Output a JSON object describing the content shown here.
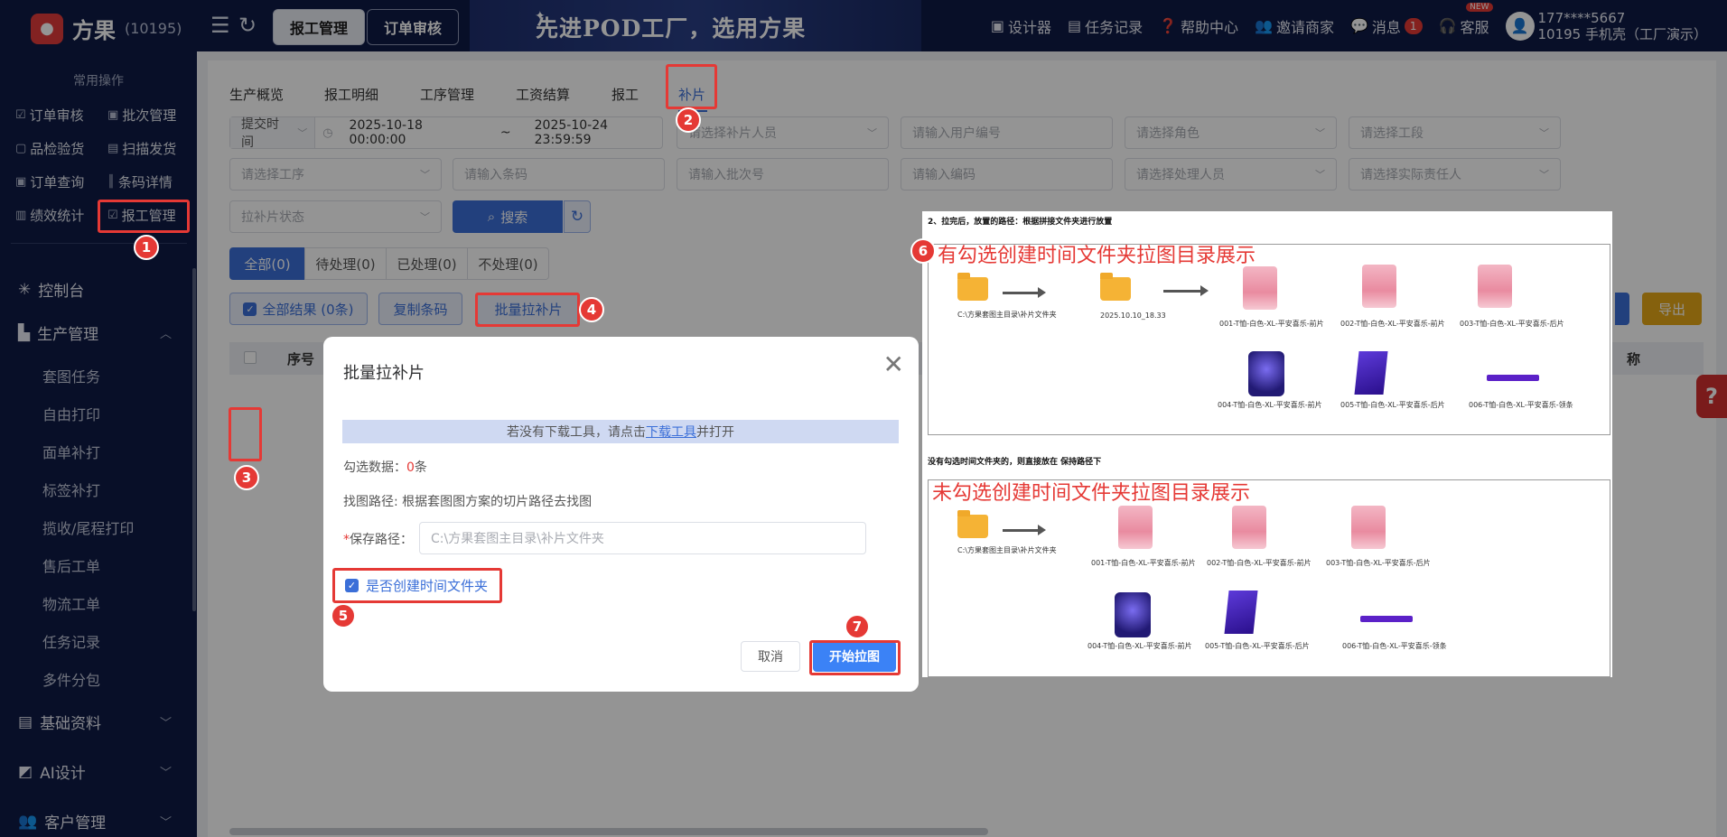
{
  "header": {
    "brand": "方果",
    "brand_count": "(10195)",
    "tabs": [
      "报工管理",
      "订单审核"
    ],
    "slogan": "先进POD工厂，选用方果",
    "links": [
      {
        "label": "设计器",
        "icon": "image-icon"
      },
      {
        "label": "任务记录",
        "icon": "list-icon"
      },
      {
        "label": "帮助中心",
        "icon": "help-icon"
      },
      {
        "label": "邀请商家",
        "icon": "user-icon"
      },
      {
        "label": "消息",
        "icon": "message-icon",
        "badge": "1"
      },
      {
        "label": "客服",
        "icon": "headset-icon",
        "tag": "NEW"
      }
    ],
    "user_phone": "177****5667",
    "user_company": "10195 手机壳（工厂演示）"
  },
  "sidebar": {
    "section_title": "常用操作",
    "quick": [
      "订单审核",
      "批次管理",
      "品检验货",
      "扫描发货",
      "订单查询",
      "条码详情",
      "绩效统计",
      "报工管理"
    ],
    "menus": [
      "控制台",
      "生产管理",
      "基础资料",
      "AI设计",
      "客户管理"
    ],
    "submenus": [
      "套图任务",
      "自由打印",
      "面单补打",
      "标签补打",
      "揽收/尾程打印",
      "售后工单",
      "物流工单",
      "任务记录",
      "多件分包"
    ]
  },
  "subtabs": [
    "生产概览",
    "报工明细",
    "工序管理",
    "工资结算",
    "报工",
    "补片"
  ],
  "filters": {
    "time_type": "提交时间",
    "start": "2025-10-18 00:00:00",
    "sep": "~",
    "end": "2025-10-24 23:59:59",
    "placeholders": [
      "请选择补片人员",
      "请输入用户编号",
      "请选择角色",
      "请选择工段",
      "请选择工序",
      "请输入条码",
      "请输入批次号",
      "请输入编码",
      "请选择处理人员",
      "请选择实际责任人",
      "拉补片状态"
    ],
    "search": "搜索"
  },
  "segments": [
    "全部(0)",
    "待处理(0)",
    "已处理(0)",
    "不处理(0)"
  ],
  "actions": {
    "all_results": "全部结果 (0条)",
    "copy_code": "复制条码",
    "batch_pull": "批量拉补片",
    "export": "导出"
  },
  "table": {
    "col_seq": "序号",
    "col_right": "称"
  },
  "dialog": {
    "title": "批量拉补片",
    "notice_pre": "若没有下载工具，请点击",
    "notice_link": "下载工具",
    "notice_post": "并打开",
    "selected_label": "勾选数据：",
    "selected_count": "0",
    "selected_unit": "条",
    "find_path": "找图路径: 根据套图图方案的切片路径去找图",
    "save_required": "*",
    "save_label": "保存路径：",
    "save_placeholder": "C:\\方果套图主目录\\补片文件夹",
    "create_folder": "是否创建时间文件夹",
    "create_folder_checked": true,
    "cancel": "取消",
    "start": "开始拉图"
  },
  "explain_image": {
    "heading1": "2、拉完后，放置的路径：根据拼接文件夹进行放置",
    "caption1": "有勾选创建时间文件夹拉图目录展示",
    "folder_path": "C:\\方果套图主目录\\补片文件夹",
    "time_folder": "2025.10.10_18.33",
    "files": [
      "001-T恤-白色-XL-平安喜乐-前片",
      "002-T恤-白色-XL-平安喜乐-前片",
      "003-T恤-白色-XL-平安喜乐-后片",
      "004-T恤-白色-XL-平安喜乐-前片",
      "005-T恤-白色-XL-平安喜乐-后片",
      "006-T恤-白色-XL-平安喜乐-领条"
    ],
    "heading2": "没有勾选时间文件夹的，则直接放在 保持路径下",
    "caption2": "未勾选创建时间文件夹拉图目录展示"
  },
  "markers": [
    "1",
    "2",
    "3",
    "4",
    "5",
    "6",
    "7"
  ],
  "help_tab": "?"
}
